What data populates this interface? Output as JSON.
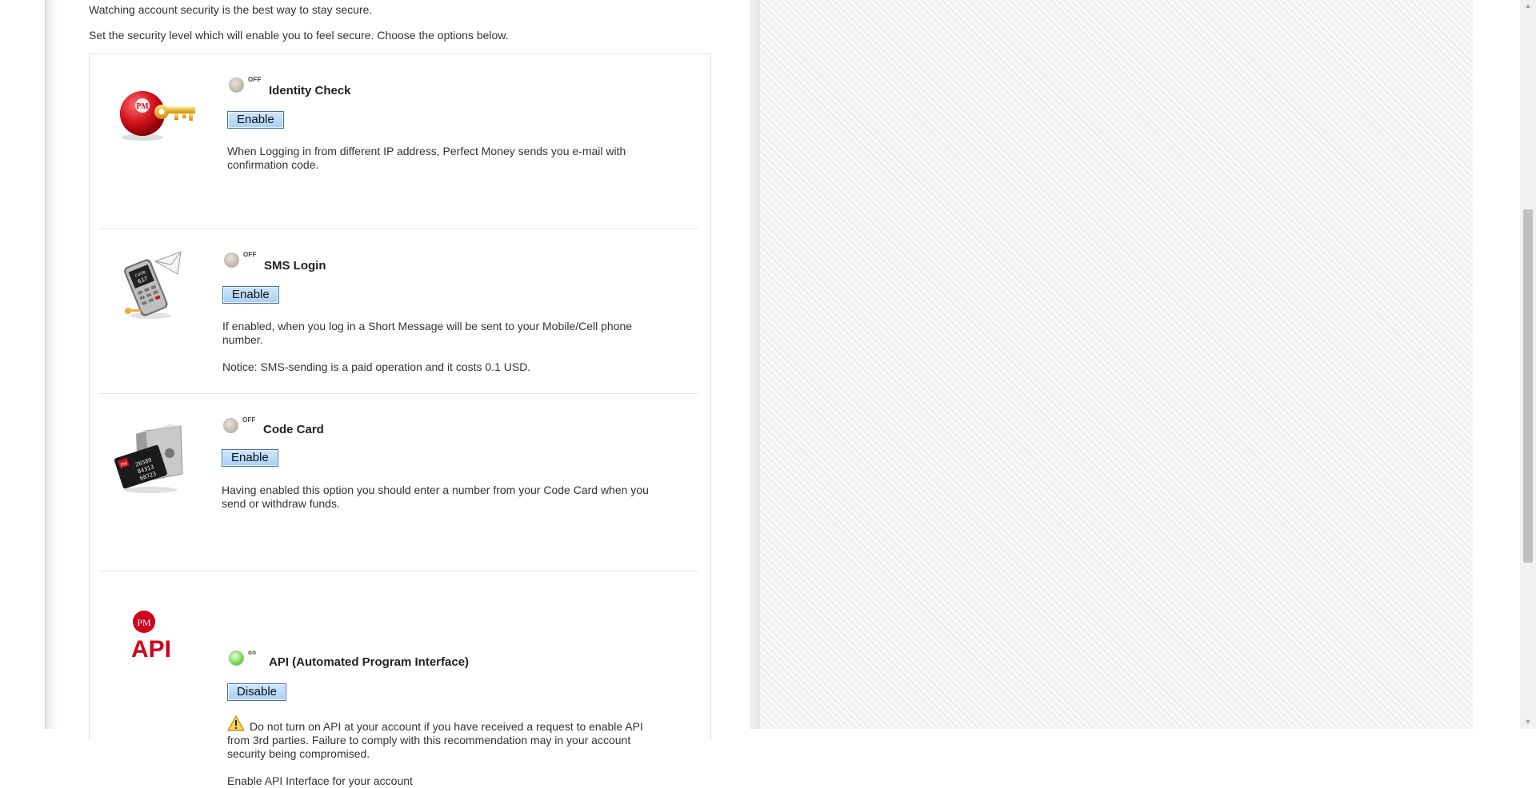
{
  "intro": {
    "line1": "Watching account security is the best way to stay secure.",
    "line2": "Set the security level which will enable you to feel secure. Choose the options below."
  },
  "options": [
    {
      "title": "Identity Check",
      "state": "OFF",
      "button": "Enable",
      "desc": [
        "When Logging in from different IP address, Perfect Money sends you e-mail with",
        "confirmation code."
      ]
    },
    {
      "title": "SMS Login",
      "state": "OFF",
      "button": "Enable",
      "desc": [
        "If enabled, when you log in a Short Message will be sent to your Mobile/Cell phone",
        "number."
      ],
      "notice": "Notice: SMS-sending is a paid operation and it costs 0.1 USD."
    },
    {
      "title": "Code Card",
      "state": "OFF",
      "button": "Enable",
      "desc": [
        "Having enabled this option you should enter a number from your Code Card when you",
        "send or withdraw funds."
      ],
      "card_digits": [
        "26589",
        "84313",
        "68723"
      ]
    },
    {
      "title": "API (Automated Program Interface)",
      "state": "on",
      "button": "Disable",
      "warning": [
        "Do not turn on API at your account if you have received a request to enable API",
        "from 3rd parties. Failure to comply with this recommendation may in your account",
        "security being compromised."
      ],
      "extra": "Enable API Interface for your account"
    }
  ],
  "logo": {
    "pm": "PM",
    "api": "API"
  },
  "colors": {
    "accent_red": "#d0021b",
    "button_bg": "#a9d0f5",
    "lamp_on": "#5fd13c"
  },
  "icons": [
    "key-icon",
    "phone-icon",
    "code-card-icon",
    "api-logo-icon",
    "warning-icon"
  ]
}
